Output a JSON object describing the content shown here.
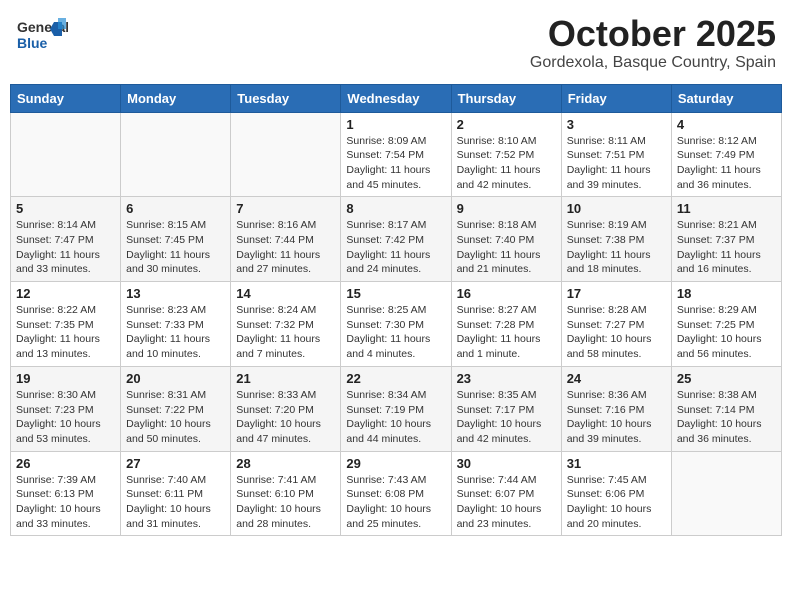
{
  "header": {
    "logo_general": "General",
    "logo_blue": "Blue",
    "month": "October 2025",
    "location": "Gordexola, Basque Country, Spain"
  },
  "weekdays": [
    "Sunday",
    "Monday",
    "Tuesday",
    "Wednesday",
    "Thursday",
    "Friday",
    "Saturday"
  ],
  "weeks": [
    [
      {
        "day": "",
        "info": ""
      },
      {
        "day": "",
        "info": ""
      },
      {
        "day": "",
        "info": ""
      },
      {
        "day": "1",
        "info": "Sunrise: 8:09 AM\nSunset: 7:54 PM\nDaylight: 11 hours\nand 45 minutes."
      },
      {
        "day": "2",
        "info": "Sunrise: 8:10 AM\nSunset: 7:52 PM\nDaylight: 11 hours\nand 42 minutes."
      },
      {
        "day": "3",
        "info": "Sunrise: 8:11 AM\nSunset: 7:51 PM\nDaylight: 11 hours\nand 39 minutes."
      },
      {
        "day": "4",
        "info": "Sunrise: 8:12 AM\nSunset: 7:49 PM\nDaylight: 11 hours\nand 36 minutes."
      }
    ],
    [
      {
        "day": "5",
        "info": "Sunrise: 8:14 AM\nSunset: 7:47 PM\nDaylight: 11 hours\nand 33 minutes."
      },
      {
        "day": "6",
        "info": "Sunrise: 8:15 AM\nSunset: 7:45 PM\nDaylight: 11 hours\nand 30 minutes."
      },
      {
        "day": "7",
        "info": "Sunrise: 8:16 AM\nSunset: 7:44 PM\nDaylight: 11 hours\nand 27 minutes."
      },
      {
        "day": "8",
        "info": "Sunrise: 8:17 AM\nSunset: 7:42 PM\nDaylight: 11 hours\nand 24 minutes."
      },
      {
        "day": "9",
        "info": "Sunrise: 8:18 AM\nSunset: 7:40 PM\nDaylight: 11 hours\nand 21 minutes."
      },
      {
        "day": "10",
        "info": "Sunrise: 8:19 AM\nSunset: 7:38 PM\nDaylight: 11 hours\nand 18 minutes."
      },
      {
        "day": "11",
        "info": "Sunrise: 8:21 AM\nSunset: 7:37 PM\nDaylight: 11 hours\nand 16 minutes."
      }
    ],
    [
      {
        "day": "12",
        "info": "Sunrise: 8:22 AM\nSunset: 7:35 PM\nDaylight: 11 hours\nand 13 minutes."
      },
      {
        "day": "13",
        "info": "Sunrise: 8:23 AM\nSunset: 7:33 PM\nDaylight: 11 hours\nand 10 minutes."
      },
      {
        "day": "14",
        "info": "Sunrise: 8:24 AM\nSunset: 7:32 PM\nDaylight: 11 hours\nand 7 minutes."
      },
      {
        "day": "15",
        "info": "Sunrise: 8:25 AM\nSunset: 7:30 PM\nDaylight: 11 hours\nand 4 minutes."
      },
      {
        "day": "16",
        "info": "Sunrise: 8:27 AM\nSunset: 7:28 PM\nDaylight: 11 hours\nand 1 minute."
      },
      {
        "day": "17",
        "info": "Sunrise: 8:28 AM\nSunset: 7:27 PM\nDaylight: 10 hours\nand 58 minutes."
      },
      {
        "day": "18",
        "info": "Sunrise: 8:29 AM\nSunset: 7:25 PM\nDaylight: 10 hours\nand 56 minutes."
      }
    ],
    [
      {
        "day": "19",
        "info": "Sunrise: 8:30 AM\nSunset: 7:23 PM\nDaylight: 10 hours\nand 53 minutes."
      },
      {
        "day": "20",
        "info": "Sunrise: 8:31 AM\nSunset: 7:22 PM\nDaylight: 10 hours\nand 50 minutes."
      },
      {
        "day": "21",
        "info": "Sunrise: 8:33 AM\nSunset: 7:20 PM\nDaylight: 10 hours\nand 47 minutes."
      },
      {
        "day": "22",
        "info": "Sunrise: 8:34 AM\nSunset: 7:19 PM\nDaylight: 10 hours\nand 44 minutes."
      },
      {
        "day": "23",
        "info": "Sunrise: 8:35 AM\nSunset: 7:17 PM\nDaylight: 10 hours\nand 42 minutes."
      },
      {
        "day": "24",
        "info": "Sunrise: 8:36 AM\nSunset: 7:16 PM\nDaylight: 10 hours\nand 39 minutes."
      },
      {
        "day": "25",
        "info": "Sunrise: 8:38 AM\nSunset: 7:14 PM\nDaylight: 10 hours\nand 36 minutes."
      }
    ],
    [
      {
        "day": "26",
        "info": "Sunrise: 7:39 AM\nSunset: 6:13 PM\nDaylight: 10 hours\nand 33 minutes."
      },
      {
        "day": "27",
        "info": "Sunrise: 7:40 AM\nSunset: 6:11 PM\nDaylight: 10 hours\nand 31 minutes."
      },
      {
        "day": "28",
        "info": "Sunrise: 7:41 AM\nSunset: 6:10 PM\nDaylight: 10 hours\nand 28 minutes."
      },
      {
        "day": "29",
        "info": "Sunrise: 7:43 AM\nSunset: 6:08 PM\nDaylight: 10 hours\nand 25 minutes."
      },
      {
        "day": "30",
        "info": "Sunrise: 7:44 AM\nSunset: 6:07 PM\nDaylight: 10 hours\nand 23 minutes."
      },
      {
        "day": "31",
        "info": "Sunrise: 7:45 AM\nSunset: 6:06 PM\nDaylight: 10 hours\nand 20 minutes."
      },
      {
        "day": "",
        "info": ""
      }
    ]
  ]
}
